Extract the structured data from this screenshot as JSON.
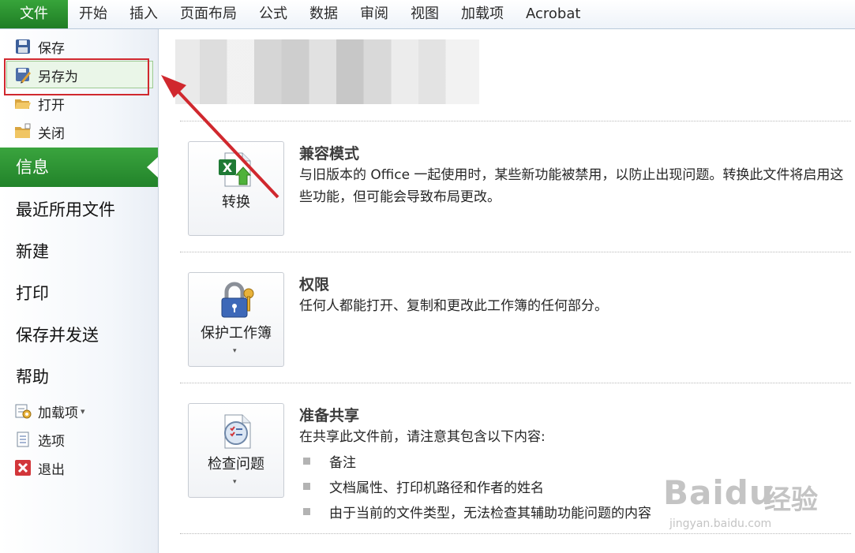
{
  "ribbon": {
    "file_tab": "文件",
    "tabs": [
      "开始",
      "插入",
      "页面布局",
      "公式",
      "数据",
      "审阅",
      "视图",
      "加载项",
      "Acrobat"
    ]
  },
  "nav": {
    "commands_top": [
      {
        "label": "保存",
        "icon": "floppy-disk-icon"
      },
      {
        "label": "另存为",
        "icon": "save-as-icon"
      },
      {
        "label": "打开",
        "icon": "folder-open-icon"
      },
      {
        "label": "关闭",
        "icon": "folder-close-icon"
      }
    ],
    "pages": [
      "信息",
      "最近所用文件",
      "新建",
      "打印",
      "保存并发送",
      "帮助"
    ],
    "commands_bottom": [
      {
        "label": "加载项",
        "icon": "addins-icon",
        "has_dropdown": true,
        "dropdown_glyph": "▾"
      },
      {
        "label": "选项",
        "icon": "options-document-icon"
      },
      {
        "label": "退出",
        "icon": "exit-icon"
      }
    ],
    "selected": "信息"
  },
  "sections": [
    {
      "button_label": "转换",
      "icon": "excel-convert-icon",
      "has_dropdown": false,
      "title": "兼容模式",
      "description": "与旧版本的 Office 一起使用时，某些新功能被禁用，以防止出现问题。转换此文件将启用这些功能，但可能会导致布局更改。"
    },
    {
      "button_label": "保护工作簿",
      "icon": "padlock-key-icon",
      "has_dropdown": true,
      "dropdown_glyph": "▾",
      "title": "权限",
      "description": "任何人都能打开、复制和更改此工作簿的任何部分。"
    },
    {
      "button_label": "检查问题",
      "icon": "inspect-checklist-icon",
      "has_dropdown": true,
      "dropdown_glyph": "▾",
      "title": "准备共享",
      "description": "在共享此文件前，请注意其包含以下内容:",
      "bullets": [
        "备注",
        "文档属性、打印机路径和作者的姓名",
        "由于当前的文件类型，无法检查其辅助功能问题的内容"
      ]
    }
  ],
  "watermark": {
    "logo": "Baidu",
    "suffix": "经验",
    "url": "jingyan.baidu.com"
  },
  "colors": {
    "file_tab_green": "#2a8f2e",
    "annotation_red": "#d0282e",
    "selected_green": "#2e9434"
  }
}
